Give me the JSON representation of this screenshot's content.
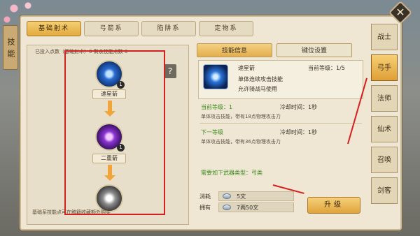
{
  "window": {
    "side_tab": "技能",
    "close_symbol": "✕"
  },
  "top_tabs": [
    "基础射术",
    "弓箭系",
    "陷阱系",
    "定物系"
  ],
  "tree": {
    "header": "已投入点数（基础射术）0   剩余技能点数 0",
    "help_symbol": "?",
    "nodes": [
      {
        "name": "速星箭",
        "level": "1"
      },
      {
        "name": "二重箭",
        "level": "1"
      },
      {
        "name": "",
        "level": ""
      }
    ],
    "footer": "基础系技能点可在触籍收藏额外购买"
  },
  "info_tabs": [
    "技能信息",
    "键位设置"
  ],
  "skill": {
    "name": "速星箭",
    "max_level_label": "当前等级：1/5",
    "desc_line1": "单体连续攻击技能",
    "desc_line2": "允许骑战马使用",
    "current_label": "当前等级：1",
    "current_cd": "冷却时间：1秒",
    "current_effect": "单体攻击技能，带有18点物理攻击力",
    "next_label": "下一等级",
    "next_cd": "冷却时间：1秒",
    "next_effect": "单体攻击技能，带有36点物理攻击力",
    "weapon_label": "需要如下武器类型：弓类"
  },
  "cost": {
    "consume_label": "消耗",
    "consume_value": "5文",
    "own_label": "拥有",
    "own_value": "7两50文"
  },
  "upgrade_label": "升级",
  "classes": [
    "战士",
    "弓手",
    "法师",
    "仙术",
    "召唤",
    "剑客"
  ],
  "active_class_index": 1,
  "colors": {
    "accent_gold": "#e2aa3e",
    "annotation_red": "#d42020",
    "level_green": "#3c8a1f"
  }
}
